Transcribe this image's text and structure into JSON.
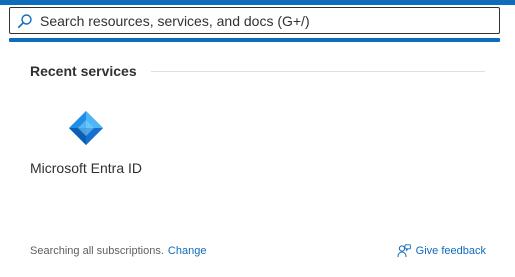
{
  "search": {
    "placeholder": "Search resources, services, and docs (G+/)",
    "value": ""
  },
  "recent_services": {
    "title": "Recent services",
    "items": [
      {
        "label": "Microsoft Entra ID",
        "icon": "entra-id-icon"
      }
    ]
  },
  "footer": {
    "status_text": "Searching all subscriptions.",
    "change_link": "Change",
    "feedback_label": "Give feedback",
    "feedback_icon": "feedback-person-icon"
  },
  "colors": {
    "accent": "#0f6cbd",
    "text": "#323130",
    "muted": "#605e5c"
  }
}
